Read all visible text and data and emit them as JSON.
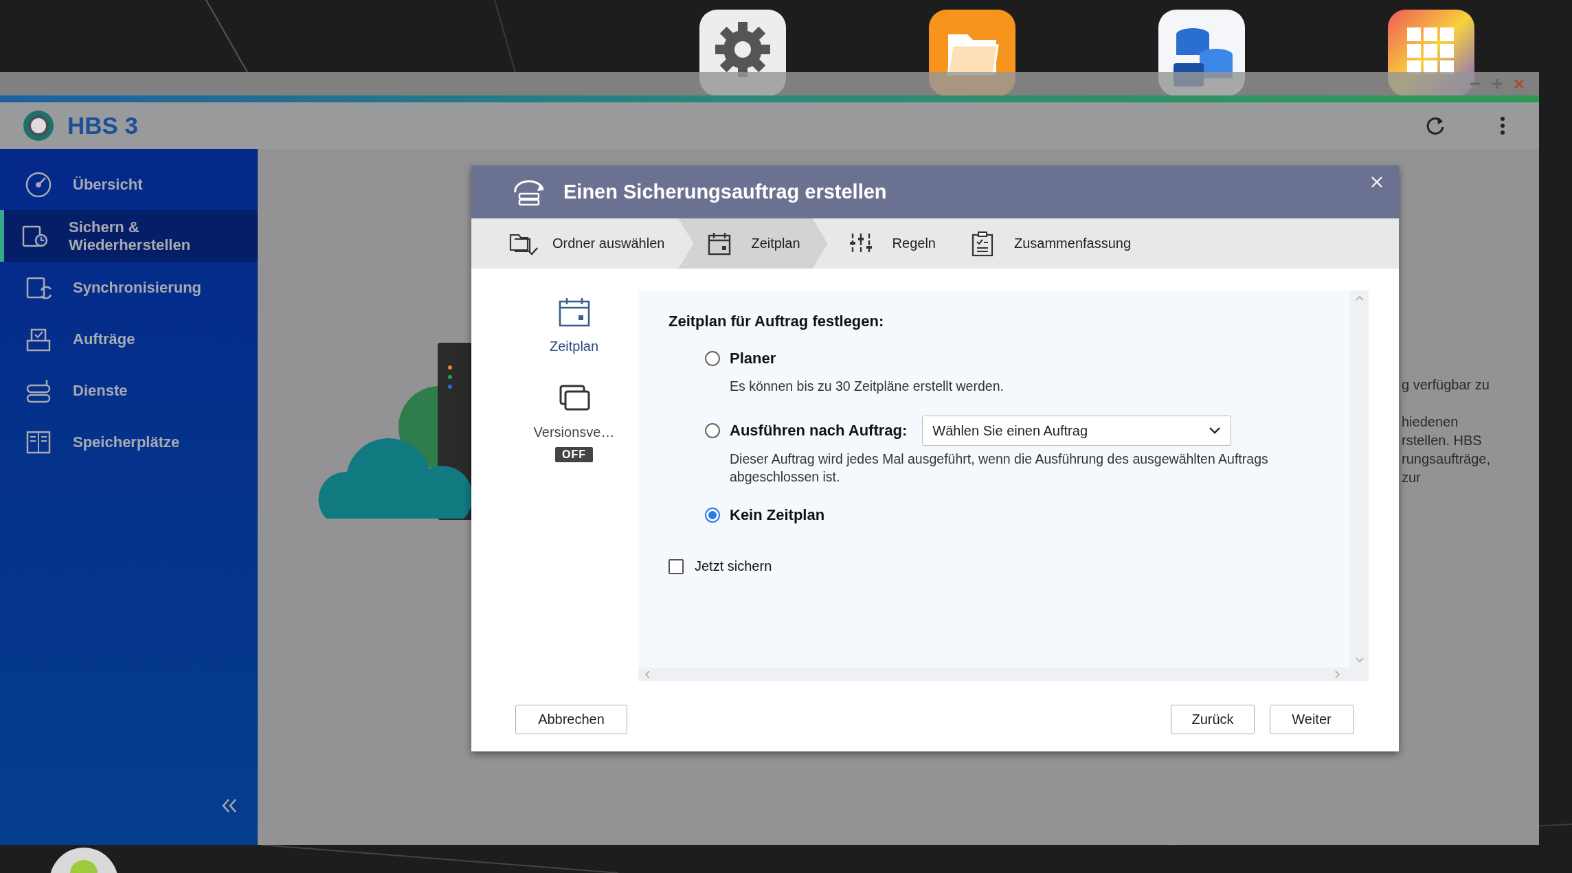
{
  "window": {
    "title": "HBS 3"
  },
  "sidebar": {
    "items": [
      {
        "label": "Übersicht",
        "selected": false
      },
      {
        "label": "Sichern & Wiederherstellen",
        "selected": true
      },
      {
        "label": "Synchronisierung",
        "selected": false
      },
      {
        "label": "Aufträge",
        "selected": false
      },
      {
        "label": "Dienste",
        "selected": false
      },
      {
        "label": "Speicherplätze",
        "selected": false
      }
    ]
  },
  "background_text": [
    "g verfügbar zu",
    "hiedenen",
    "rstellen. HBS",
    "rungsaufträge,",
    "zur"
  ],
  "dialog": {
    "title": "Einen Sicherungsauftrag erstellen",
    "steps": [
      {
        "label": "Ordner auswählen",
        "selected": false
      },
      {
        "label": "Zeitplan",
        "selected": true
      },
      {
        "label": "Regeln",
        "selected": false
      },
      {
        "label": "Zusammenfassung",
        "selected": false
      }
    ],
    "side_items": [
      {
        "label": "Zeitplan",
        "selected": true
      },
      {
        "label": "Versionsve…",
        "selected": false,
        "badge": "OFF"
      }
    ],
    "heading": "Zeitplan für Auftrag festlegen:",
    "options": [
      {
        "label": "Planer",
        "selected": false,
        "description": "Es können bis zu 30 Zeitpläne erstellt werden."
      },
      {
        "label": "Ausführen nach Auftrag:",
        "selected": false,
        "dropdown": "Wählen Sie einen Auftrag",
        "description": "Dieser Auftrag wird jedes Mal ausgeführt, wenn die Ausführung des ausgewählten Auftrags abgeschlossen ist."
      },
      {
        "label": "Kein Zeitplan",
        "selected": true
      }
    ],
    "checkbox": {
      "label": "Jetzt sichern",
      "checked": false
    },
    "buttons": [
      {
        "label": "Abbrechen"
      },
      {
        "label": "Zurück"
      },
      {
        "label": "Weiter"
      }
    ]
  }
}
